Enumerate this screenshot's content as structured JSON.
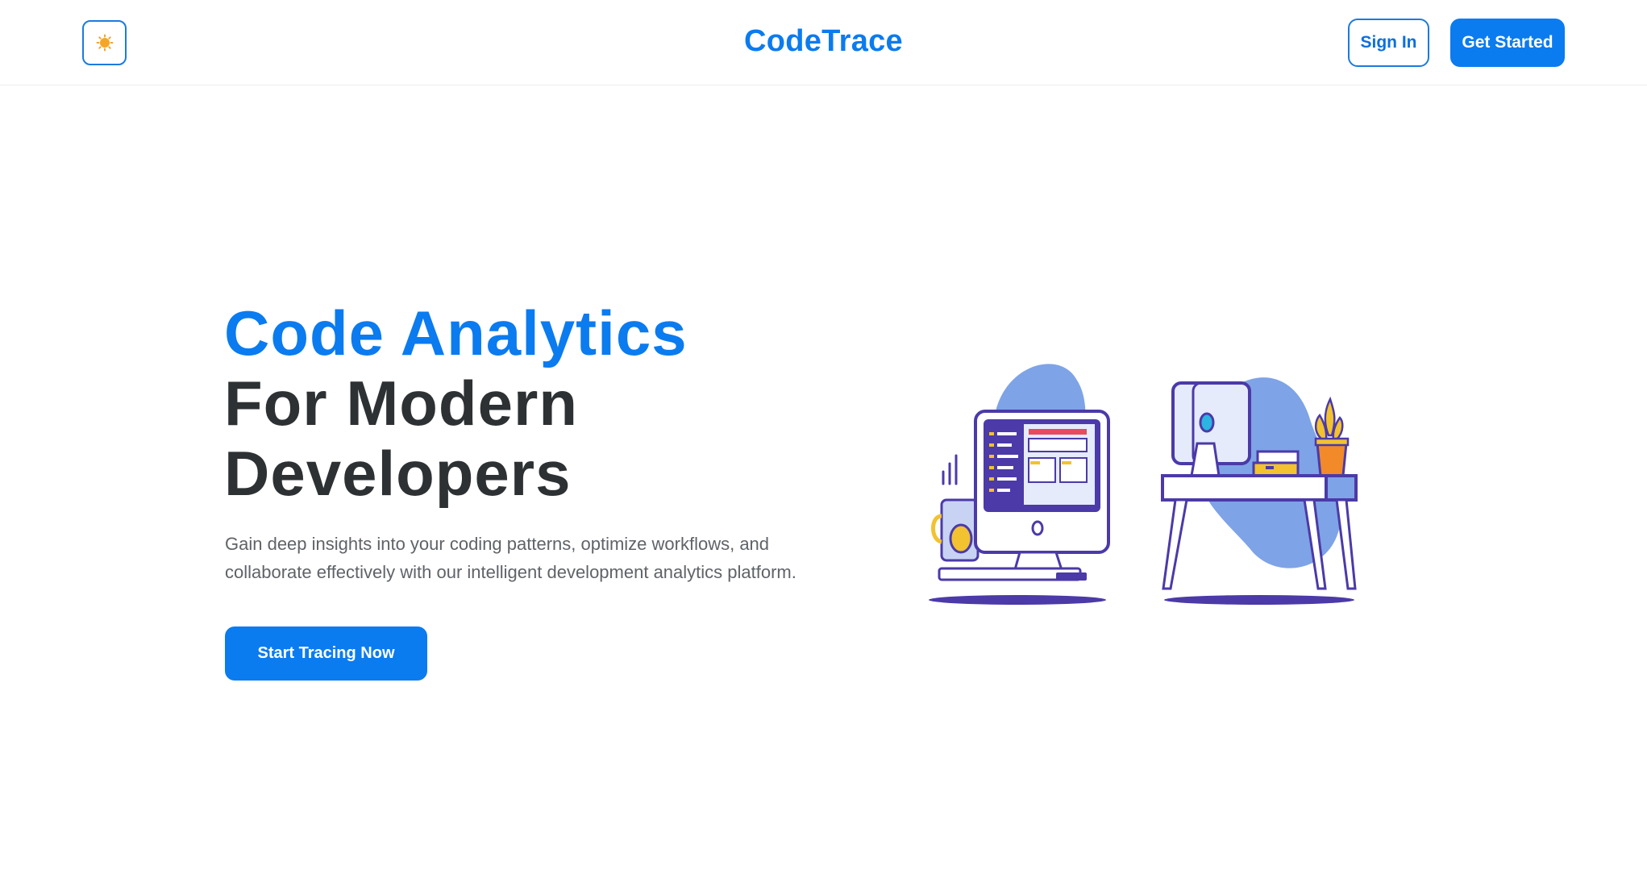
{
  "header": {
    "theme_toggle_icon": "sun-icon",
    "brand": "CodeTrace",
    "sign_in": "Sign In",
    "get_started": "Get Started"
  },
  "hero": {
    "title_line1": "Code Analytics",
    "title_line2": "For Modern",
    "title_line3": "Developers",
    "subtitle_line1": "Gain deep insights into your coding patterns, optimize workflows, and",
    "subtitle_line2": "collaborate effectively with our intelligent development analytics platform.",
    "cta": "Start Tracing Now"
  },
  "colors": {
    "accent": "#0b7bf0",
    "heading_dark": "#2d3133",
    "body_text": "#5f6368",
    "illustration_blob": "#7ea3e6",
    "illustration_outline": "#4b3aa8",
    "illustration_yellow": "#f2c230",
    "illustration_orange": "#f28a2a"
  },
  "illustration": {
    "name": "developer-workspace-illustration"
  }
}
